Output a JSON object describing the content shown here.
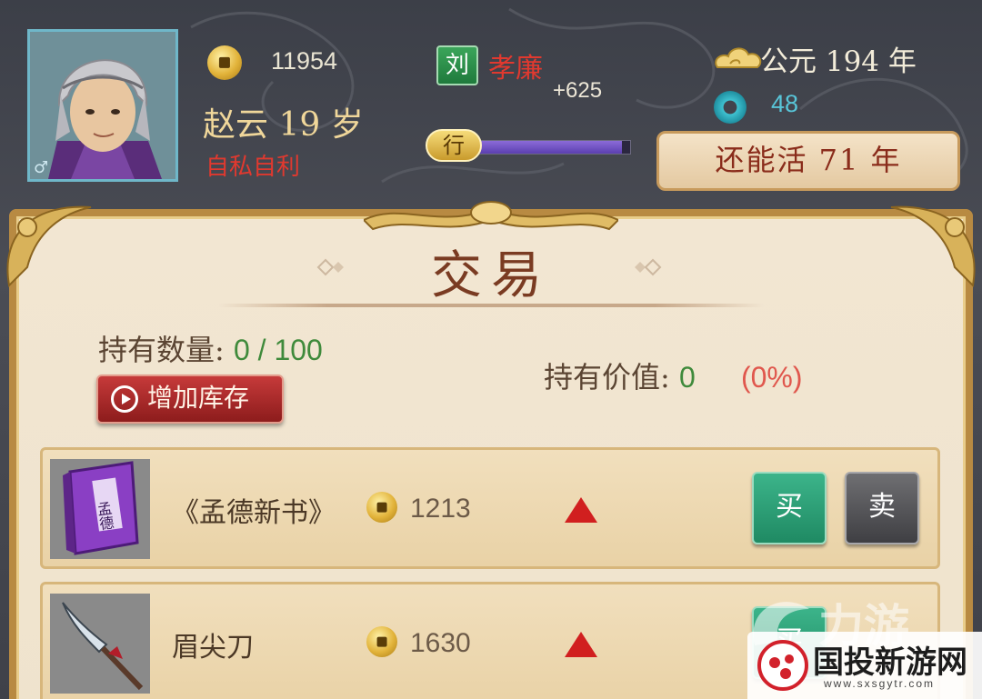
{
  "header": {
    "gold": "11954",
    "hero_name": "赵云 19 岁",
    "hero_trait": "自私自利",
    "faction_char": "刘",
    "rank_title": "孝廉",
    "rank_points": "+625",
    "action_char": "行",
    "action_level": 0.95,
    "era": "公元 194 年",
    "jade": "48",
    "life_left": "还能活 71 年"
  },
  "panel": {
    "title": "交易",
    "hold_qty_label": "持有数量:",
    "hold_qty_value": "0 / 100",
    "hold_value_label": "持有价值:",
    "hold_value_value": "0",
    "hold_value_pct": "(0%)",
    "add_stock_label": "增加库存"
  },
  "items": [
    {
      "name": "《孟德新书》",
      "price": "1213",
      "trend": "up",
      "book_label": "孟德",
      "buy_label": "买",
      "sell_label": "卖"
    },
    {
      "name": "眉尖刀",
      "price": "1630",
      "trend": "up",
      "buy_label": "买"
    }
  ],
  "watermark": {
    "name": "国投新游网",
    "url": "www.sxsgytr.com"
  },
  "colors": {
    "trend_up": "#d11f1f",
    "buy": "#1f8a63",
    "sell": "#3f3f43",
    "accent_gold": "#b88a42"
  }
}
